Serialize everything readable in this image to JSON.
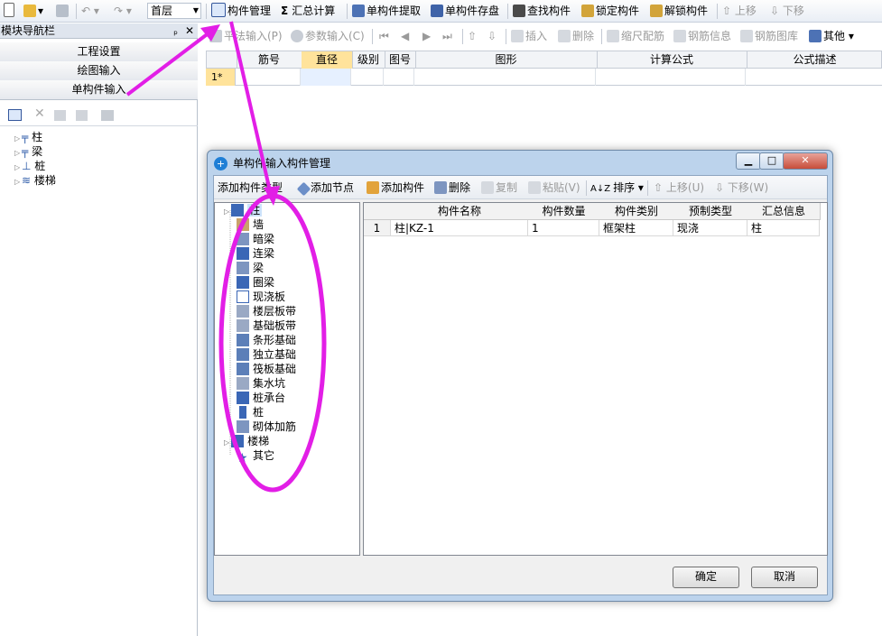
{
  "toolbar": {
    "floor": "首层",
    "component_manage": "构件管理",
    "summary_calc": "汇总计算",
    "single_extract": "单构件提取",
    "single_save": "单构件存盘",
    "find_component": "查找构件",
    "lock_component": "锁定构件",
    "unlock_component": "解锁构件",
    "move_up": "上移",
    "move_down": "下移"
  },
  "nav": {
    "title": "模块导航栏",
    "pin": "ₚ",
    "close": "✕",
    "tabs": [
      "工程设置",
      "绘图输入",
      "单构件输入"
    ],
    "tree": [
      "柱",
      "梁",
      "桩",
      "楼梯"
    ]
  },
  "toolbar2": {
    "plan_input": "平法输入(P)",
    "param_input": "参数输入(C)",
    "insert": "插入",
    "delete": "删除",
    "scale_rebar": "缩尺配筋",
    "rebar_info": "钢筋信息",
    "rebar_lib": "钢筋图库",
    "other": "其他"
  },
  "grid": {
    "headers": [
      "筋号",
      "直径(mm)",
      "级别",
      "图号",
      "图形",
      "计算公式",
      "公式描述"
    ],
    "row_marker": "1*"
  },
  "dialog": {
    "title": "单构件输入构件管理",
    "toolbar": {
      "add_type": "添加构件类型",
      "add_node": "添加节点",
      "add_component": "添加构件",
      "delete": "删除",
      "copy": "复制",
      "paste": "粘贴(V)",
      "sort": "排序",
      "up": "上移(U)",
      "down": "下移(W)"
    },
    "tree": [
      "柱",
      "墙",
      "暗梁",
      "连梁",
      "梁",
      "圈梁",
      "现浇板",
      "楼层板带",
      "基础板带",
      "条形基础",
      "独立基础",
      "筏板基础",
      "集水坑",
      "桩承台",
      "桩",
      "砌体加筋",
      "楼梯",
      "其它"
    ],
    "table_headers": [
      "构件名称",
      "构件数量",
      "构件类别",
      "预制类型",
      "汇总信息"
    ],
    "rows": [
      {
        "index": "1",
        "name": "柱|KZ-1",
        "count": "1",
        "category": "框架柱",
        "prefab": "现浇",
        "summary": "柱"
      }
    ],
    "ok": "确定",
    "cancel": "取消"
  },
  "colors": {
    "accent": "#e21ee6",
    "header_highlight": "#ffe39b",
    "selected_row": "#e6f0ff"
  }
}
